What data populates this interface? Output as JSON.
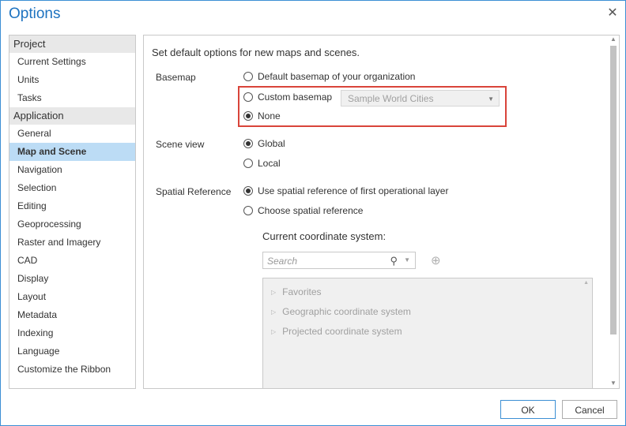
{
  "window": {
    "title": "Options"
  },
  "nav": {
    "sections": [
      {
        "title": "Project",
        "items": [
          "Current Settings",
          "Units",
          "Tasks"
        ]
      },
      {
        "title": "Application",
        "items": [
          "General",
          "Map and Scene",
          "Navigation",
          "Selection",
          "Editing",
          "Geoprocessing",
          "Raster and Imagery",
          "CAD",
          "Display",
          "Layout",
          "Metadata",
          "Indexing",
          "Language",
          "Customize the Ribbon"
        ]
      }
    ],
    "selected": "Map and Scene"
  },
  "content": {
    "heading": "Set default options for new maps and scenes.",
    "basemap": {
      "label": "Basemap",
      "options": [
        "Default basemap of your organization",
        "Custom basemap",
        "None"
      ],
      "selected": "None",
      "custom_value": "Sample World Cities"
    },
    "scene_view": {
      "label": "Scene view",
      "options": [
        "Global",
        "Local"
      ],
      "selected": "Global"
    },
    "spatial_reference": {
      "label": "Spatial Reference",
      "options": [
        "Use spatial reference of first operational layer",
        "Choose spatial reference"
      ],
      "selected": "Use spatial reference of first operational layer"
    },
    "coordinate": {
      "heading": "Current coordinate system:",
      "search_placeholder": "Search",
      "tree": [
        "Favorites",
        "Geographic coordinate system",
        "Projected coordinate system"
      ]
    }
  },
  "footer": {
    "ok": "OK",
    "cancel": "Cancel"
  },
  "colors": {
    "accent": "#1e73c0",
    "selected_nav": "#bcdcf5",
    "highlight": "#d9443a"
  }
}
